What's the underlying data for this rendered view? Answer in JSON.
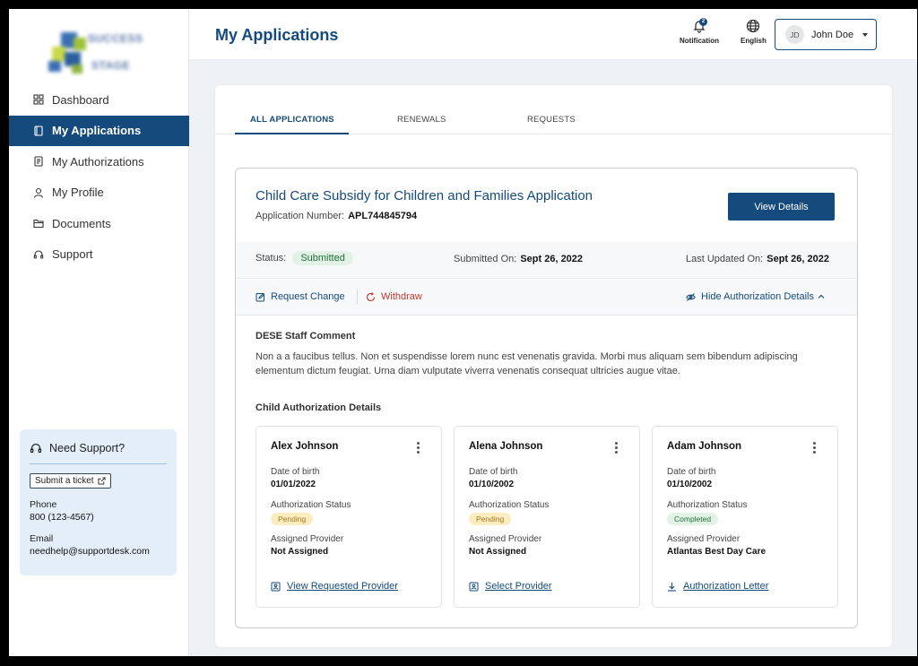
{
  "header": {
    "title": "My Applications",
    "notification_label": "Notification",
    "notification_count": "2",
    "language_label": "English",
    "user_initials": "JD",
    "user_name": "John Doe"
  },
  "sidebar": {
    "items": [
      {
        "label": "Dashboard",
        "icon": "dashboard-grid-icon"
      },
      {
        "label": "My Applications",
        "icon": "book-icon",
        "active": true
      },
      {
        "label": "My Authorizations",
        "icon": "document-icon"
      },
      {
        "label": "My Profile",
        "icon": "person-icon"
      },
      {
        "label": "Documents",
        "icon": "folder-icon"
      },
      {
        "label": "Support",
        "icon": "headset-icon"
      }
    ],
    "support": {
      "title": "Need Support?",
      "ticket_label": "Submit a ticket",
      "phone_label": "Phone",
      "phone_value": "800 (123-4567)",
      "email_label": "Email",
      "email_value": "needhelp@supportdesk.com"
    }
  },
  "tabs": [
    {
      "label": "ALL APPLICATIONS",
      "active": true
    },
    {
      "label": "RENEWALS"
    },
    {
      "label": "REQUESTS"
    }
  ],
  "application": {
    "title": "Child Care Subsidy for Children and Families Application",
    "number_label": "Application Number:",
    "number_value": "APL744845794",
    "view_button": "View Details",
    "status_label": "Status:",
    "status_value": "Submitted",
    "submitted_label": "Submitted On:",
    "submitted_value": "Sept 26, 2022",
    "updated_label": "Last Updated On:",
    "updated_value": "Sept 26, 2022",
    "request_change": "Request Change",
    "withdraw": "Withdraw",
    "hide_details": "Hide Authorization Details",
    "comment_title": "DESE Staff Comment",
    "comment_text": "Non a a faucibus tellus. Non et suspendisse lorem nunc est venenatis gravida. Morbi mus aliquam sem bibendum adipiscing elementum dictum feugiat. Urna diam vulputate viverra venenatis consequat ultricies augue vitae.",
    "children_title": "Child Authorization Details",
    "children": [
      {
        "name": "Alex Johnson",
        "dob_label": "Date of birth",
        "dob": "01/01/2022",
        "auth_label": "Authorization Status",
        "auth_status": "Pending",
        "provider_label": "Assigned Provider",
        "provider": "Not Assigned",
        "link": "View Requested Provider"
      },
      {
        "name": "Alena Johnson",
        "dob_label": "Date of birth",
        "dob": "01/10/2002",
        "auth_label": "Authorization Status",
        "auth_status": "Pending",
        "provider_label": "Assigned Provider",
        "provider": "Not Assigned",
        "link": "Select Provider"
      },
      {
        "name": "Adam Johnson",
        "dob_label": "Date of birth",
        "dob": "01/10/2002",
        "auth_label": "Authorization Status",
        "auth_status": "Completed",
        "provider_label": "Assigned Provider",
        "provider": "Atlantas Best Day Care",
        "link": "Authorization Letter"
      }
    ]
  },
  "colors": {
    "primary": "#154a7d",
    "withdraw": "#c0392b",
    "success_bg": "#e3f2e6",
    "pending_bg": "#fcecc0"
  }
}
